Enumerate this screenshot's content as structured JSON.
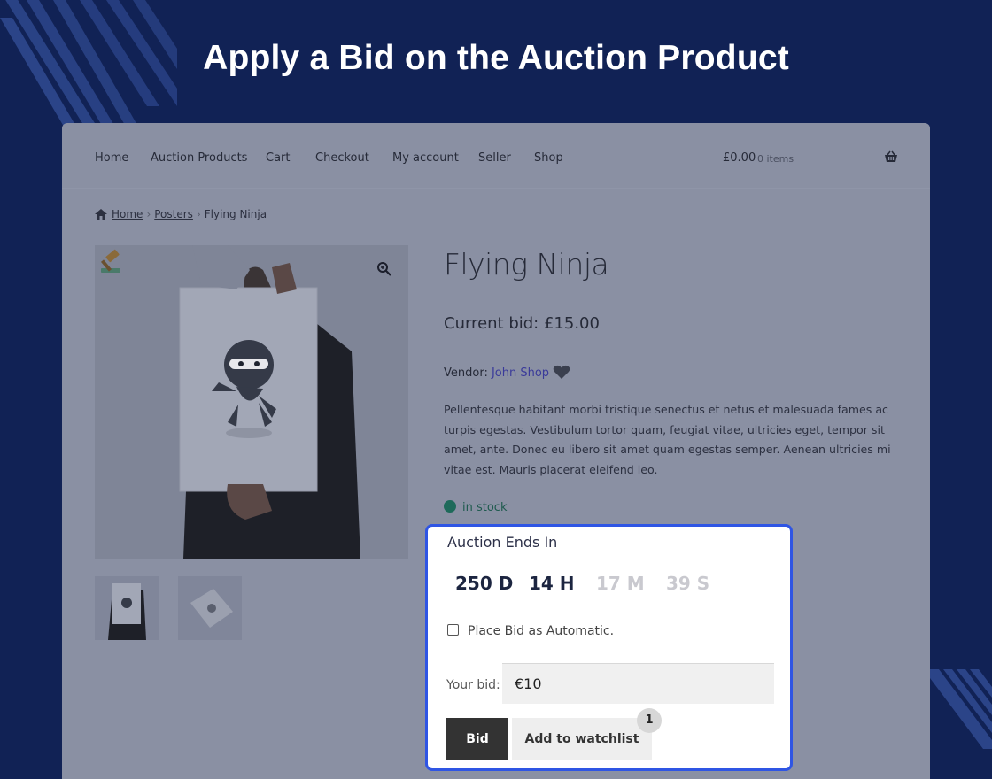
{
  "headline": "Apply a Bid on the Auction Product",
  "nav": {
    "items": [
      "Home",
      "Auction Products",
      "Cart",
      "Checkout",
      "My account",
      "Seller",
      "Shop"
    ],
    "cart_total": "£0.00",
    "cart_count": "0 items"
  },
  "breadcrumb": {
    "home": "Home",
    "category": "Posters",
    "current": "Flying Ninja"
  },
  "product": {
    "title": "Flying Ninja",
    "current_bid": "Current bid: £15.00",
    "vendor_label": "Vendor:",
    "vendor_name": "John Shop",
    "description": "Pellentesque habitant morbi tristique senectus et netus et malesuada fames ac turpis egestas. Vestibulum tortor quam, feugiat vitae, ultricies eget, tempor sit amet, ante. Donec eu libero sit amet quam egestas semper. Aenean ultricies mi vitae est. Mauris placerat eleifend leo.",
    "stock": "in stock"
  },
  "auction": {
    "ends_label": "Auction Ends In",
    "days": "250 D",
    "hours": "14 H",
    "minutes": "17 M",
    "seconds": "39 S",
    "auto_label": "Place Bid as Automatic.",
    "your_bid_label": "Your bid:",
    "bid_value": "€10",
    "bid_button": "Bid",
    "watchlist_button": "Add to watchlist",
    "step_badge": "1"
  },
  "colors": {
    "background": "#112255",
    "highlight": "#2f55e4",
    "overlay": "#8a90a3"
  }
}
